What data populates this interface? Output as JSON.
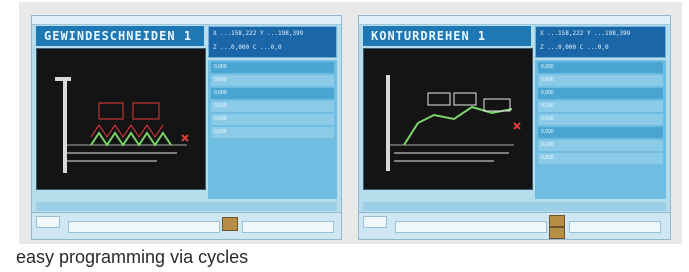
{
  "caption": "easy programming via cycles",
  "screens": [
    {
      "title": "GEWINDESCHNEIDEN 1",
      "coords": [
        "X ...158,222  Y ...198,399",
        "Z ...0,000  C ...0,0"
      ],
      "params": [
        "0,000",
        "0,000",
        "0,000",
        "0,000",
        "0,000",
        "0,000"
      ]
    },
    {
      "title": "KONTURDREHEN 1",
      "coords": [
        "X ...158,222  Y ...198,399",
        "Z ...0,000  C ...0,0"
      ],
      "params": [
        "0,000",
        "0,000",
        "0,000",
        "0,000",
        "0,000",
        "0,000",
        "0,000",
        "0,000"
      ]
    }
  ],
  "colors": {
    "title_bar": "#1e78b4",
    "panel": "#6fbde0",
    "canvas": "#141414"
  }
}
